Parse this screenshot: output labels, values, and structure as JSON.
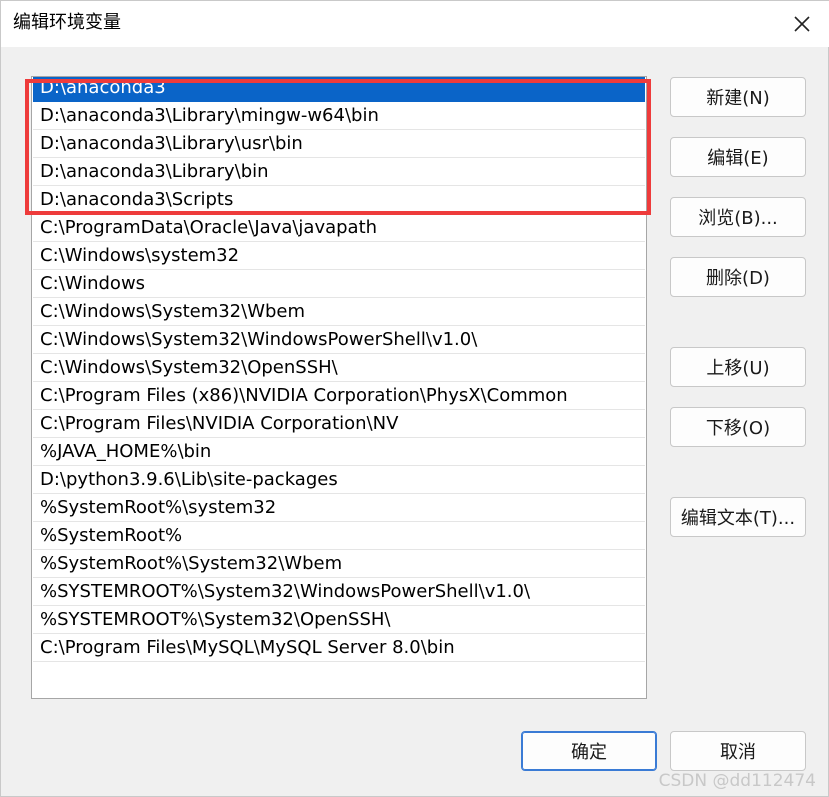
{
  "window": {
    "title": "编辑环境变量",
    "close_icon": "close-icon"
  },
  "path_list": {
    "items": [
      "D:\\anaconda3",
      "D:\\anaconda3\\Library\\mingw-w64\\bin",
      "D:\\anaconda3\\Library\\usr\\bin",
      "D:\\anaconda3\\Library\\bin",
      "D:\\anaconda3\\Scripts",
      "C:\\ProgramData\\Oracle\\Java\\javapath",
      "C:\\Windows\\system32",
      "C:\\Windows",
      "C:\\Windows\\System32\\Wbem",
      "C:\\Windows\\System32\\WindowsPowerShell\\v1.0\\",
      "C:\\Windows\\System32\\OpenSSH\\",
      "C:\\Program Files (x86)\\NVIDIA Corporation\\PhysX\\Common",
      "C:\\Program Files\\NVIDIA Corporation\\NV",
      "%JAVA_HOME%\\bin",
      "D:\\python3.9.6\\Lib\\site-packages",
      "%SystemRoot%\\system32",
      "%SystemRoot%",
      "%SystemRoot%\\System32\\Wbem",
      "%SYSTEMROOT%\\System32\\WindowsPowerShell\\v1.0\\",
      "%SYSTEMROOT%\\System32\\OpenSSH\\",
      "C:\\Program Files\\MySQL\\MySQL Server 8.0\\bin"
    ],
    "selected_index": 0
  },
  "buttons": {
    "new": "新建(N)",
    "edit": "编辑(E)",
    "browse": "浏览(B)...",
    "delete": "删除(D)",
    "move_up": "上移(U)",
    "move_down": "下移(O)",
    "edit_text": "编辑文本(T)...",
    "ok": "确定",
    "cancel": "取消"
  },
  "watermark": "CSDN @dd112474",
  "colors": {
    "selection": "#0a64c8",
    "highlight_box": "#ee3b3b"
  }
}
